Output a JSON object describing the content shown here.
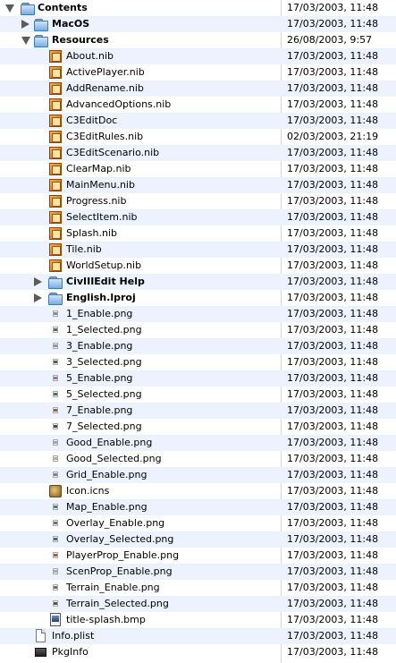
{
  "rows": [
    {
      "name": "Contents",
      "date": "17/03/2003, 11:48",
      "indent": 0,
      "type": "folder",
      "bold": true,
      "disclosure": "open"
    },
    {
      "name": "MacOS",
      "date": "17/03/2003, 11:48",
      "indent": 1,
      "type": "folder",
      "bold": true,
      "disclosure": "closed"
    },
    {
      "name": "Resources",
      "date": "26/08/2003, 9:57",
      "indent": 1,
      "type": "folder",
      "bold": true,
      "disclosure": "open"
    },
    {
      "name": "About.nib",
      "date": "17/03/2003, 11:48",
      "indent": 2,
      "type": "nib"
    },
    {
      "name": "ActivePlayer.nib",
      "date": "17/03/2003, 11:48",
      "indent": 2,
      "type": "nib"
    },
    {
      "name": "AddRename.nib",
      "date": "17/03/2003, 11:48",
      "indent": 2,
      "type": "nib"
    },
    {
      "name": "AdvancedOptions.nib",
      "date": "17/03/2003, 11:48",
      "indent": 2,
      "type": "nib"
    },
    {
      "name": "C3EditDoc",
      "date": "17/03/2003, 11:48",
      "indent": 2,
      "type": "nib"
    },
    {
      "name": "C3EditRules.nib",
      "date": "02/03/2003, 21:19",
      "indent": 2,
      "type": "nib"
    },
    {
      "name": "C3EditScenario.nib",
      "date": "17/03/2003, 11:48",
      "indent": 2,
      "type": "nib"
    },
    {
      "name": "ClearMap.nib",
      "date": "17/03/2003, 11:48",
      "indent": 2,
      "type": "nib"
    },
    {
      "name": "MainMenu.nib",
      "date": "17/03/2003, 11:48",
      "indent": 2,
      "type": "nib"
    },
    {
      "name": "Progress.nib",
      "date": "17/03/2003, 11:48",
      "indent": 2,
      "type": "nib"
    },
    {
      "name": "SelectItem.nib",
      "date": "17/03/2003, 11:48",
      "indent": 2,
      "type": "nib"
    },
    {
      "name": "Splash.nib",
      "date": "17/03/2003, 11:48",
      "indent": 2,
      "type": "nib"
    },
    {
      "name": "Tile.nib",
      "date": "17/03/2003, 11:48",
      "indent": 2,
      "type": "nib"
    },
    {
      "name": "WorldSetup.nib",
      "date": "17/03/2003, 11:48",
      "indent": 2,
      "type": "nib"
    },
    {
      "name": "CivIIIEdit Help",
      "date": "17/03/2003, 11:48",
      "indent": 2,
      "type": "folder",
      "bold": true,
      "disclosure": "closed"
    },
    {
      "name": "English.lproj",
      "date": "17/03/2003, 11:48",
      "indent": 2,
      "type": "folder",
      "bold": true,
      "disclosure": "closed"
    },
    {
      "name": "1_Enable.png",
      "date": "17/03/2003, 11:48",
      "indent": 2,
      "type": "png",
      "color": "#8a8a8a"
    },
    {
      "name": "1_Selected.png",
      "date": "17/03/2003, 11:48",
      "indent": 2,
      "type": "png",
      "color": "#3f7a56"
    },
    {
      "name": "3_Enable.png",
      "date": "17/03/2003, 11:48",
      "indent": 2,
      "type": "png",
      "color": "#9a8f8f"
    },
    {
      "name": "3_Selected.png",
      "date": "17/03/2003, 11:48",
      "indent": 2,
      "type": "png",
      "color": "#3a6a4a"
    },
    {
      "name": "5_Enable.png",
      "date": "17/03/2003, 11:48",
      "indent": 2,
      "type": "png",
      "color": "#b06a8a"
    },
    {
      "name": "5_Selected.png",
      "date": "17/03/2003, 11:48",
      "indent": 2,
      "type": "png",
      "color": "#3f7a56"
    },
    {
      "name": "7_Enable.png",
      "date": "17/03/2003, 11:48",
      "indent": 2,
      "type": "png",
      "color": "#c04a4a"
    },
    {
      "name": "7_Selected.png",
      "date": "17/03/2003, 11:48",
      "indent": 2,
      "type": "png",
      "color": "#6a3a3a"
    },
    {
      "name": "Good_Enable.png",
      "date": "17/03/2003, 11:48",
      "indent": 2,
      "type": "png",
      "color": "#a0a0c0"
    },
    {
      "name": "Good_Selected.png",
      "date": "17/03/2003, 11:48",
      "indent": 2,
      "type": "png",
      "color": "#c0b090"
    },
    {
      "name": "Grid_Enable.png",
      "date": "17/03/2003, 11:48",
      "indent": 2,
      "type": "png",
      "color": "#808080"
    },
    {
      "name": "Icon.icns",
      "date": "17/03/2003, 11:48",
      "indent": 2,
      "type": "icns"
    },
    {
      "name": "Map_Enable.png",
      "date": "17/03/2003, 11:48",
      "indent": 2,
      "type": "png",
      "color": "#4a7aa0"
    },
    {
      "name": "Overlay_Enable.png",
      "date": "17/03/2003, 11:48",
      "indent": 2,
      "type": "png",
      "color": "#707070"
    },
    {
      "name": "Overlay_Selected.png",
      "date": "17/03/2003, 11:48",
      "indent": 2,
      "type": "png",
      "color": "#3f7a56"
    },
    {
      "name": "PlayerProp_Enable.png",
      "date": "17/03/2003, 11:48",
      "indent": 2,
      "type": "png",
      "color": "#c05050"
    },
    {
      "name": "ScenProp_Enable.png",
      "date": "17/03/2003, 11:48",
      "indent": 2,
      "type": "png",
      "color": "#a0b0a0"
    },
    {
      "name": "Terrain_Enable.png",
      "date": "17/03/2003, 11:48",
      "indent": 2,
      "type": "png",
      "color": "#707070"
    },
    {
      "name": "Terrain_Selected.png",
      "date": "17/03/2003, 11:48",
      "indent": 2,
      "type": "png",
      "color": "#6a4a3a"
    },
    {
      "name": "title-splash.bmp",
      "date": "17/03/2003, 11:48",
      "indent": 2,
      "type": "bmp"
    },
    {
      "name": "Info.plist",
      "date": "17/03/2003, 11:48",
      "indent": 1,
      "type": "doc"
    },
    {
      "name": "PkgInfo",
      "date": "17/03/2003, 11:48",
      "indent": 1,
      "type": "pkginfo"
    }
  ]
}
